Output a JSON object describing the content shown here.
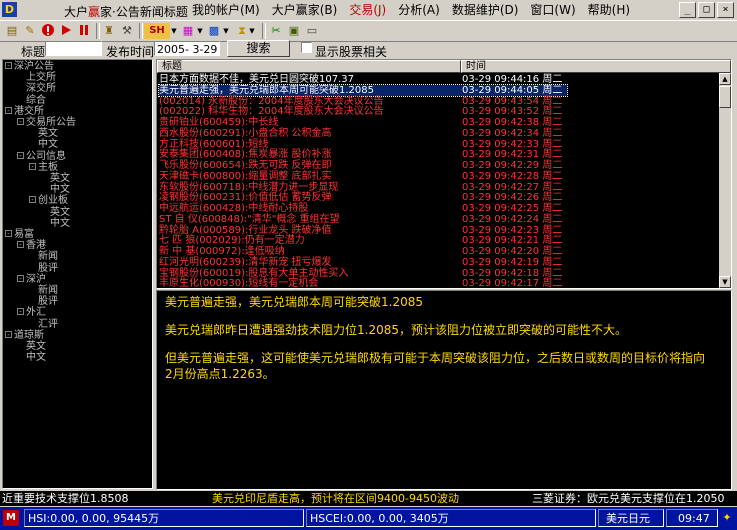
{
  "window": {
    "title_pre": "大户",
    "title_red": "赢",
    "title_post": "家·公告新闻标题",
    "controls": {
      "minimize": "_",
      "restore": "□",
      "close": "×"
    }
  },
  "menu": [
    {
      "label": "我的帐户(M)"
    },
    {
      "label": "大户赢家(B)"
    },
    {
      "label": "交易(J)"
    },
    {
      "label": "分析(A)"
    },
    {
      "label": "数据维护(D)"
    },
    {
      "label": "窗口(W)"
    },
    {
      "label": "帮助(H)"
    }
  ],
  "toolbar": {
    "sh_label": "SH"
  },
  "search": {
    "title_label": "标题",
    "title_value": "",
    "date_label": "发布时间",
    "date_value": "2005- 3-29",
    "search_button": "搜索",
    "show_related_label": "显示股票相关"
  },
  "tree": [
    {
      "label": "深沪公告",
      "level": 0,
      "box": "-"
    },
    {
      "label": "上交所",
      "level": 1
    },
    {
      "label": "深交所",
      "level": 1
    },
    {
      "label": "综合",
      "level": 1
    },
    {
      "label": "港交所",
      "level": 0,
      "box": "-"
    },
    {
      "label": "交易所公告",
      "level": 1,
      "box": "-"
    },
    {
      "label": "英文",
      "level": 2
    },
    {
      "label": "中文",
      "level": 2
    },
    {
      "label": "公司信息",
      "level": 1,
      "box": "-"
    },
    {
      "label": "主板",
      "level": 2,
      "box": "-"
    },
    {
      "label": "英文",
      "level": 3
    },
    {
      "label": "中文",
      "level": 3
    },
    {
      "label": "创业板",
      "level": 2,
      "box": "-"
    },
    {
      "label": "英文",
      "level": 3
    },
    {
      "label": "中文",
      "level": 3
    },
    {
      "label": "易富",
      "level": 0,
      "box": "-"
    },
    {
      "label": "香港",
      "level": 1,
      "box": "-"
    },
    {
      "label": "新闻",
      "level": 2
    },
    {
      "label": "股评",
      "level": 2
    },
    {
      "label": "深沪",
      "level": 1,
      "box": "-"
    },
    {
      "label": "新闻",
      "level": 2
    },
    {
      "label": "股评",
      "level": 2
    },
    {
      "label": "外汇",
      "level": 1,
      "box": "-"
    },
    {
      "label": "汇评",
      "level": 2
    },
    {
      "label": "道琼斯",
      "level": 0,
      "box": "-"
    },
    {
      "label": "英文",
      "level": 1
    },
    {
      "label": "中文",
      "level": 1
    }
  ],
  "news_list": {
    "col_title": "标题",
    "col_time": "时间",
    "rows": [
      {
        "title": "日本方面数据不佳，美元兑日圆突破107.37",
        "time": "03-29 09:44:16 周二",
        "color": "#ffffff"
      },
      {
        "title": "美元普遍走强，美元兑瑞郎本周可能突破1.2085",
        "time": "03-29 09:44:05 周二",
        "color": "#ffffff",
        "selected": true
      },
      {
        "title": "(002014) 永新股份：2004年度股东大会决议公告",
        "time": "03-29 09:43:54 周二",
        "color": "#ff3333"
      },
      {
        "title": "(002022) 科华生物：2004年度股东大会决议公告",
        "time": "03-29 09:43:52 周二",
        "color": "#ff3333"
      },
      {
        "title": "贵研铂业(600459):中长线",
        "time": "03-29 09:42:38 周二",
        "color": "#ff3333"
      },
      {
        "title": "西水股份(600291):小盘合积 公积金高",
        "time": "03-29 09:42:34 周二",
        "color": "#ff3333"
      },
      {
        "title": "方正科技(600601):短线",
        "time": "03-29 09:42:33 周二",
        "color": "#ff3333"
      },
      {
        "title": "安泰集团(600408):焦炭暴涨 股价补涨",
        "time": "03-29 09:42:31 周二",
        "color": "#ff3333"
      },
      {
        "title": "飞乐股份(600654):跌无可跌 反弹在即",
        "time": "03-29 09:42:29 周二",
        "color": "#ff3333"
      },
      {
        "title": "天津磁卡(600800):缩量调整 底部扎实",
        "time": "03-29 09:42:28 周二",
        "color": "#ff3333"
      },
      {
        "title": "东软股份(600718):中线潜力进一步显现",
        "time": "03-29 09:42:27 周二",
        "color": "#ff3333"
      },
      {
        "title": "凌钢股份(600231):价值低估 蓄势反弹",
        "time": "03-29 09:42:26 周二",
        "color": "#ff3333"
      },
      {
        "title": "中远航运(600428):中线耐心持股",
        "time": "03-29 09:42:25 周二",
        "color": "#ff3333"
      },
      {
        "title": "ST 自 仪(600848):\"清华\"概念 重组在望",
        "time": "03-29 09:42:24 周二",
        "color": "#ff3333"
      },
      {
        "title": "黔轮胎 A(000589):行业龙头 跌破净值",
        "time": "03-29 09:42:23 周二",
        "color": "#ff3333"
      },
      {
        "title": "七 匹 狼(002029):仍有一定潜力",
        "time": "03-29 09:42:21 周二",
        "color": "#ff3333"
      },
      {
        "title": "新 中 基(000972):逢低吸纳",
        "time": "03-29 09:42:20 周二",
        "color": "#ff3333"
      },
      {
        "title": "红河光明(600239):清华新宠 扭亏爆发",
        "time": "03-29 09:42:19 周二",
        "color": "#ff3333"
      },
      {
        "title": "宝钢股份(600019):股息有大单主动性买入",
        "time": "03-29 09:42:18 周二",
        "color": "#ff3333"
      },
      {
        "title": "丰原生化(000930):短线有一定机会",
        "time": "03-29 09:42:17 周二",
        "color": "#ff3333"
      }
    ]
  },
  "detail": {
    "headline": "美元普遍走强，美元兑瑞郎本周可能突破1.2085",
    "para1": "美元兑瑞郎昨日遭遇强劲技术阻力位1.2085，预计该阻力位被立即突破的可能性不大。",
    "para2": "但美元普遍走强，这可能使美元兑瑞郎极有可能于本周突破该阻力位，之后数日或数周的目标价将指向2月份高点1.2263。"
  },
  "ticker": {
    "left": "近重要技术支撑位1.8508",
    "middle": "美元兑印尼盾走高，预计将在区间9400-9450波动",
    "right": "三菱证券：欧元兑美元支撑位在1.2050"
  },
  "status": {
    "hsi": "HSI:0.00, 0.00, 95445万",
    "hscei": "HSCEI:0.00, 0.00, 3405万",
    "mode": "美元日元",
    "time": "09:47"
  }
}
